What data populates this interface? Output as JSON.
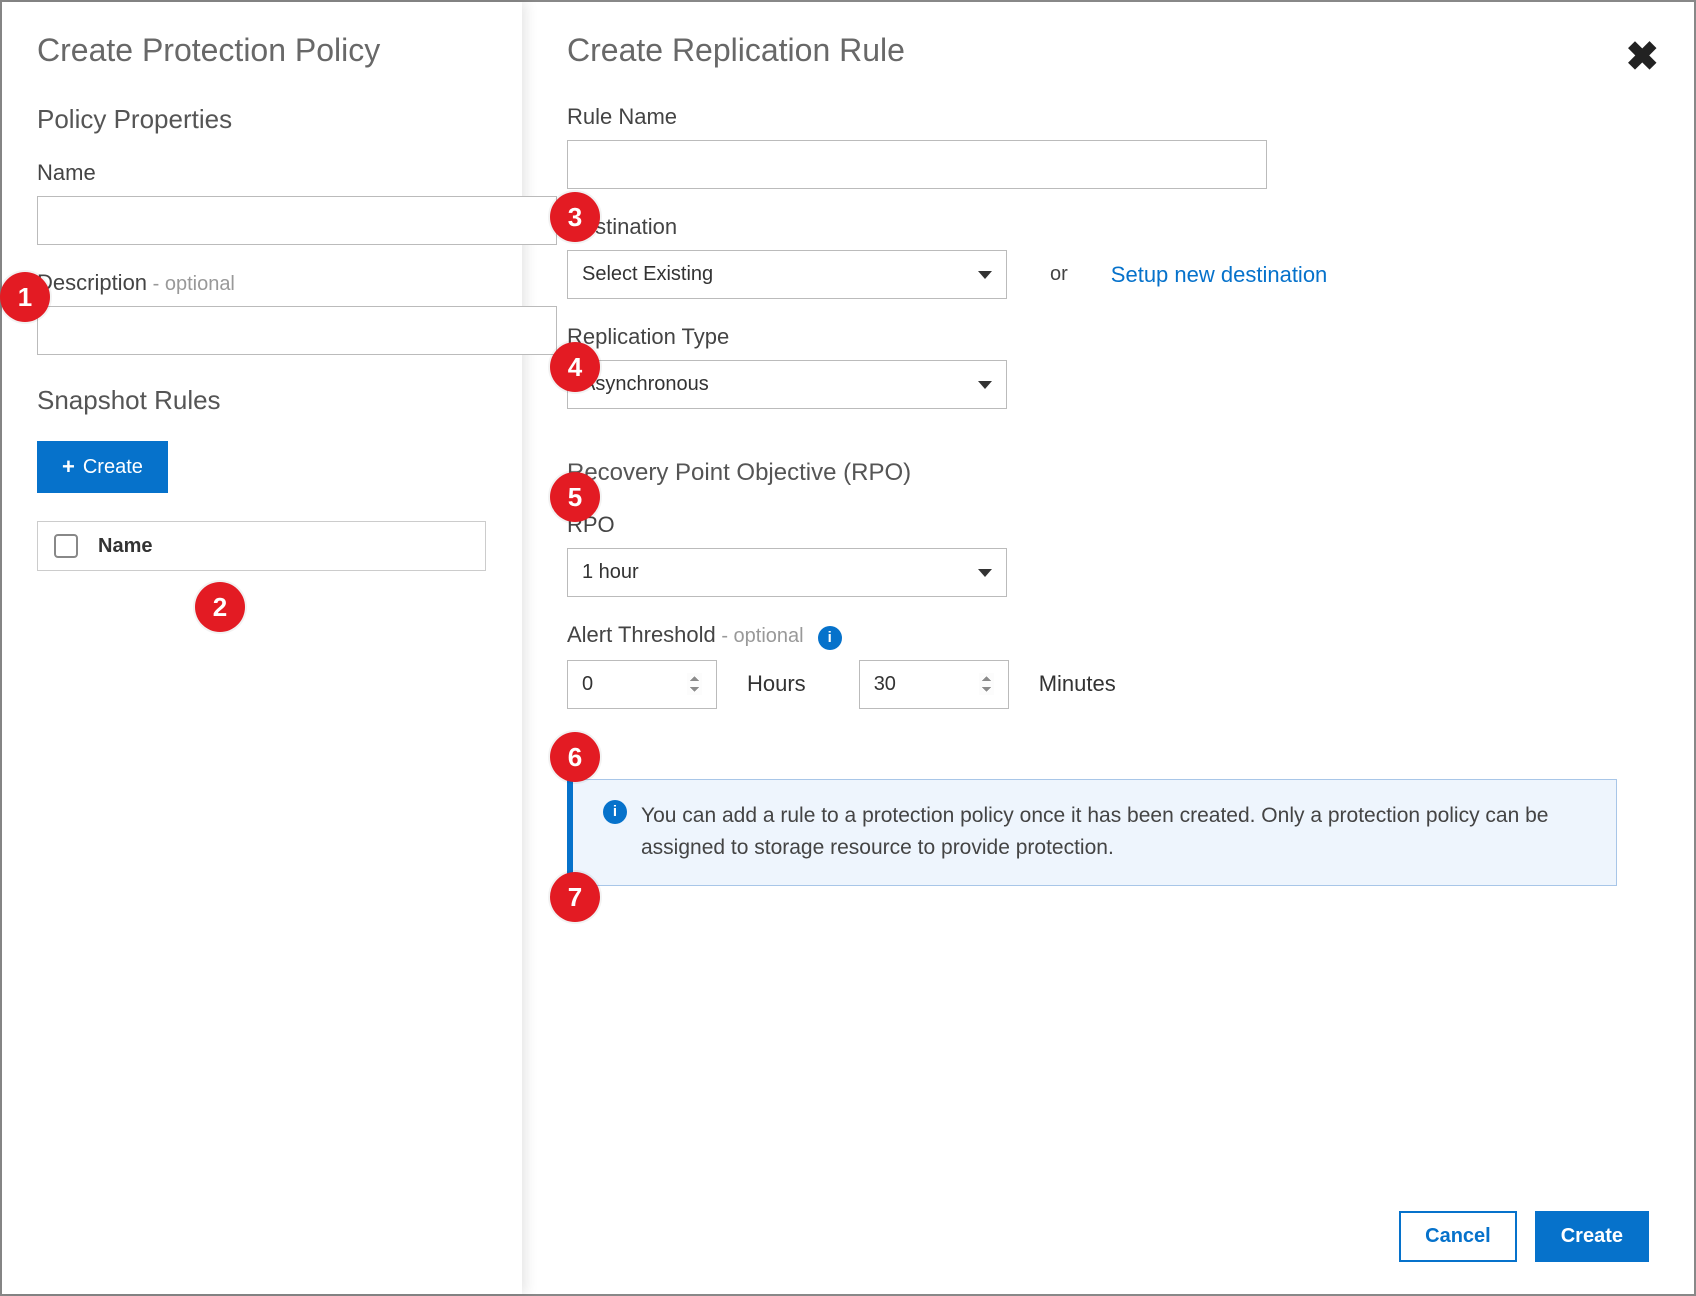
{
  "left": {
    "title": "Create Protection Policy",
    "properties_heading": "Policy Properties",
    "name_label": "Name",
    "name_value": "",
    "description_label": "Description",
    "description_optional": " - optional",
    "description_value": "",
    "snapshot_heading": "Snapshot Rules",
    "create_btn": "Create",
    "table_col_name": "Name"
  },
  "right": {
    "title": "Create Replication Rule",
    "rule_name_label": "Rule Name",
    "rule_name_value": "",
    "destination_label": "Destination",
    "destination_value": "Select Existing",
    "or_text": "or",
    "setup_link": "Setup new destination",
    "replication_type_label": "Replication Type",
    "replication_type_value": "Asynchronous",
    "rpo_heading": "Recovery Point Objective (RPO)",
    "rpo_label": "RPO",
    "rpo_value": "1 hour",
    "alert_label": "Alert Threshold",
    "alert_optional": " - optional",
    "alert_hours": "0",
    "hours_unit": "Hours",
    "alert_minutes": "30",
    "minutes_unit": "Minutes",
    "info_text": "You can add a rule to a protection policy once it has been created. Only a protection policy can be assigned to storage resource to provide protection.",
    "cancel_btn": "Cancel",
    "create_btn": "Create"
  },
  "badges": {
    "b1": "1",
    "b2": "2",
    "b3": "3",
    "b4": "4",
    "b5": "5",
    "b6": "6",
    "b7": "7"
  }
}
